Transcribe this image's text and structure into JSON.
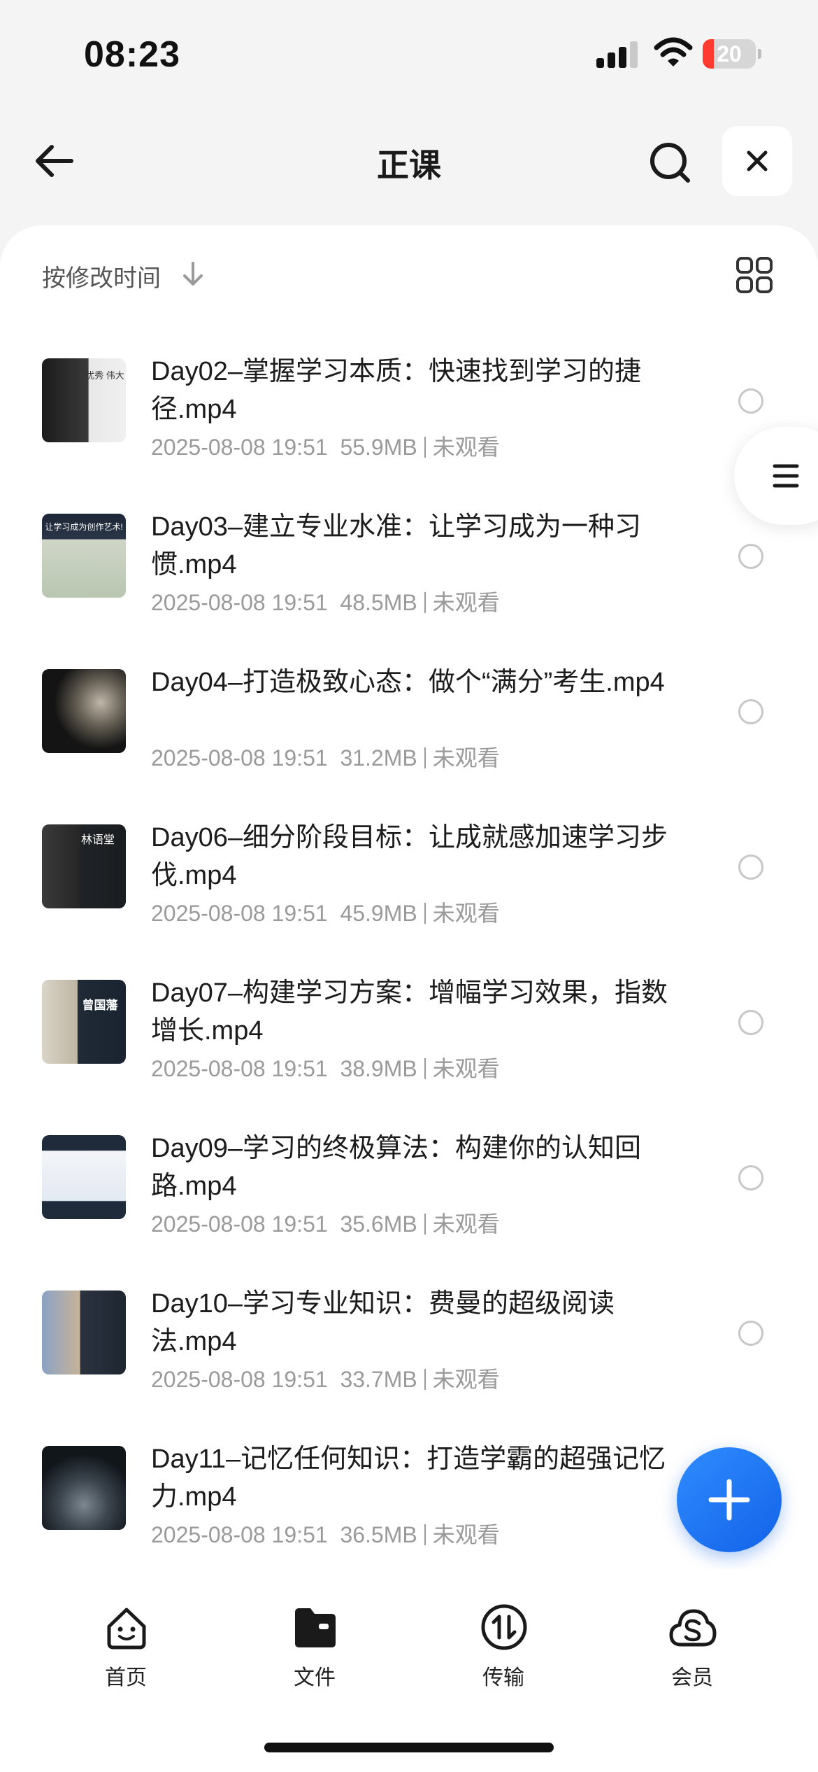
{
  "status_bar": {
    "time": "08:23",
    "battery": "20"
  },
  "header": {
    "title": "正课"
  },
  "sort": {
    "label": "按修改时间"
  },
  "files": [
    {
      "name": "Day02–掌握学习本质：快速找到学习的捷径.mp4",
      "date": "2025-08-08 19:51",
      "size": "55.9MB",
      "status": "未观看",
      "thumb_text": "优秀 伟大"
    },
    {
      "name": "Day03–建立专业水准：让学习成为一种习惯.mp4",
      "date": "2025-08-08 19:51",
      "size": "48.5MB",
      "status": "未观看",
      "thumb_text": "让学习成为创作艺术!"
    },
    {
      "name": "Day04–打造极致心态：做个“满分”考生.mp4",
      "date": "2025-08-08 19:51",
      "size": "31.2MB",
      "status": "未观看",
      "thumb_text": ""
    },
    {
      "name": "Day06–细分阶段目标：让成就感加速学习步伐.mp4",
      "date": "2025-08-08 19:51",
      "size": "45.9MB",
      "status": "未观看",
      "thumb_text": "林语堂"
    },
    {
      "name": "Day07–构建学习方案：增幅学习效果，指数增长.mp4",
      "date": "2025-08-08 19:51",
      "size": "38.9MB",
      "status": "未观看",
      "thumb_text": "曾国藩"
    },
    {
      "name": "Day09–学习的终极算法：构建你的认知回路.mp4",
      "date": "2025-08-08 19:51",
      "size": "35.6MB",
      "status": "未观看",
      "thumb_text": ""
    },
    {
      "name": "Day10–学习专业知识：费曼的超级阅读法.mp4",
      "date": "2025-08-08 19:51",
      "size": "33.7MB",
      "status": "未观看",
      "thumb_text": ""
    },
    {
      "name": "Day11–记忆任何知识：打造学霸的超强记忆力.mp4",
      "date": "2025-08-08 19:51",
      "size": "36.5MB",
      "status": "未观看",
      "thumb_text": ""
    }
  ],
  "tabs": [
    {
      "label": "首页",
      "icon": "smile-face-icon"
    },
    {
      "label": "文件",
      "icon": "folder-icon"
    },
    {
      "label": "传输",
      "icon": "transfer-icon"
    },
    {
      "label": "会员",
      "icon": "cloud-s-icon"
    }
  ],
  "colors": {
    "accent": "#1a6ff0",
    "battery_low": "#ff3b30"
  }
}
